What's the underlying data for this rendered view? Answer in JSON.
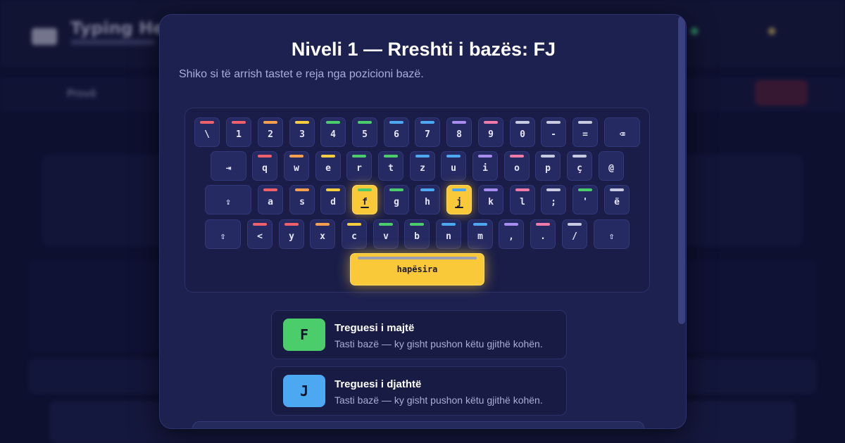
{
  "background": {
    "app_title": "Typing Hero",
    "tab_label": "Provë"
  },
  "modal": {
    "title": "Niveli 1 — Rreshti i bazës: FJ",
    "subtitle": "Shiko si të arrish tastet e reja nga pozicioni bazë."
  },
  "keyboard": {
    "rows": [
      [
        "\\",
        "1",
        "2",
        "3",
        "4",
        "5",
        "6",
        "7",
        "8",
        "9",
        "0",
        "-",
        "=",
        "⌫"
      ],
      [
        "⇥",
        "q",
        "w",
        "e",
        "r",
        "t",
        "z",
        "u",
        "i",
        "o",
        "p",
        "ç",
        "@"
      ],
      [
        "⇪",
        "a",
        "s",
        "d",
        "f",
        "g",
        "h",
        "j",
        "k",
        "l",
        ";",
        "'",
        "ë"
      ],
      [
        "⇧",
        "<",
        "y",
        "x",
        "c",
        "v",
        "b",
        "n",
        "m",
        ",",
        ".",
        "/",
        "⇧"
      ]
    ],
    "space_label": "hapësira",
    "highlighted_keys": [
      "f",
      "j"
    ],
    "finger_colors": {
      "red": "#f0606a",
      "orange": "#f6a04e",
      "yellow": "#f6cd3c",
      "green": "#4ccd6c",
      "blue": "#4da8f2",
      "purple": "#a98cf0",
      "pink": "#f07aa8",
      "gray": "#c8cbe0"
    }
  },
  "fingers": [
    {
      "key": "F",
      "title": "Treguesi i majtë",
      "description": "Tasti bazë — ky gisht pushon këtu gjithë kohën.",
      "color": "#4ccd6c"
    },
    {
      "key": "J",
      "title": "Treguesi i djathtë",
      "description": "Tasti bazë — ky gisht pushon këtu gjithë kohën.",
      "color": "#4da8f2"
    }
  ]
}
